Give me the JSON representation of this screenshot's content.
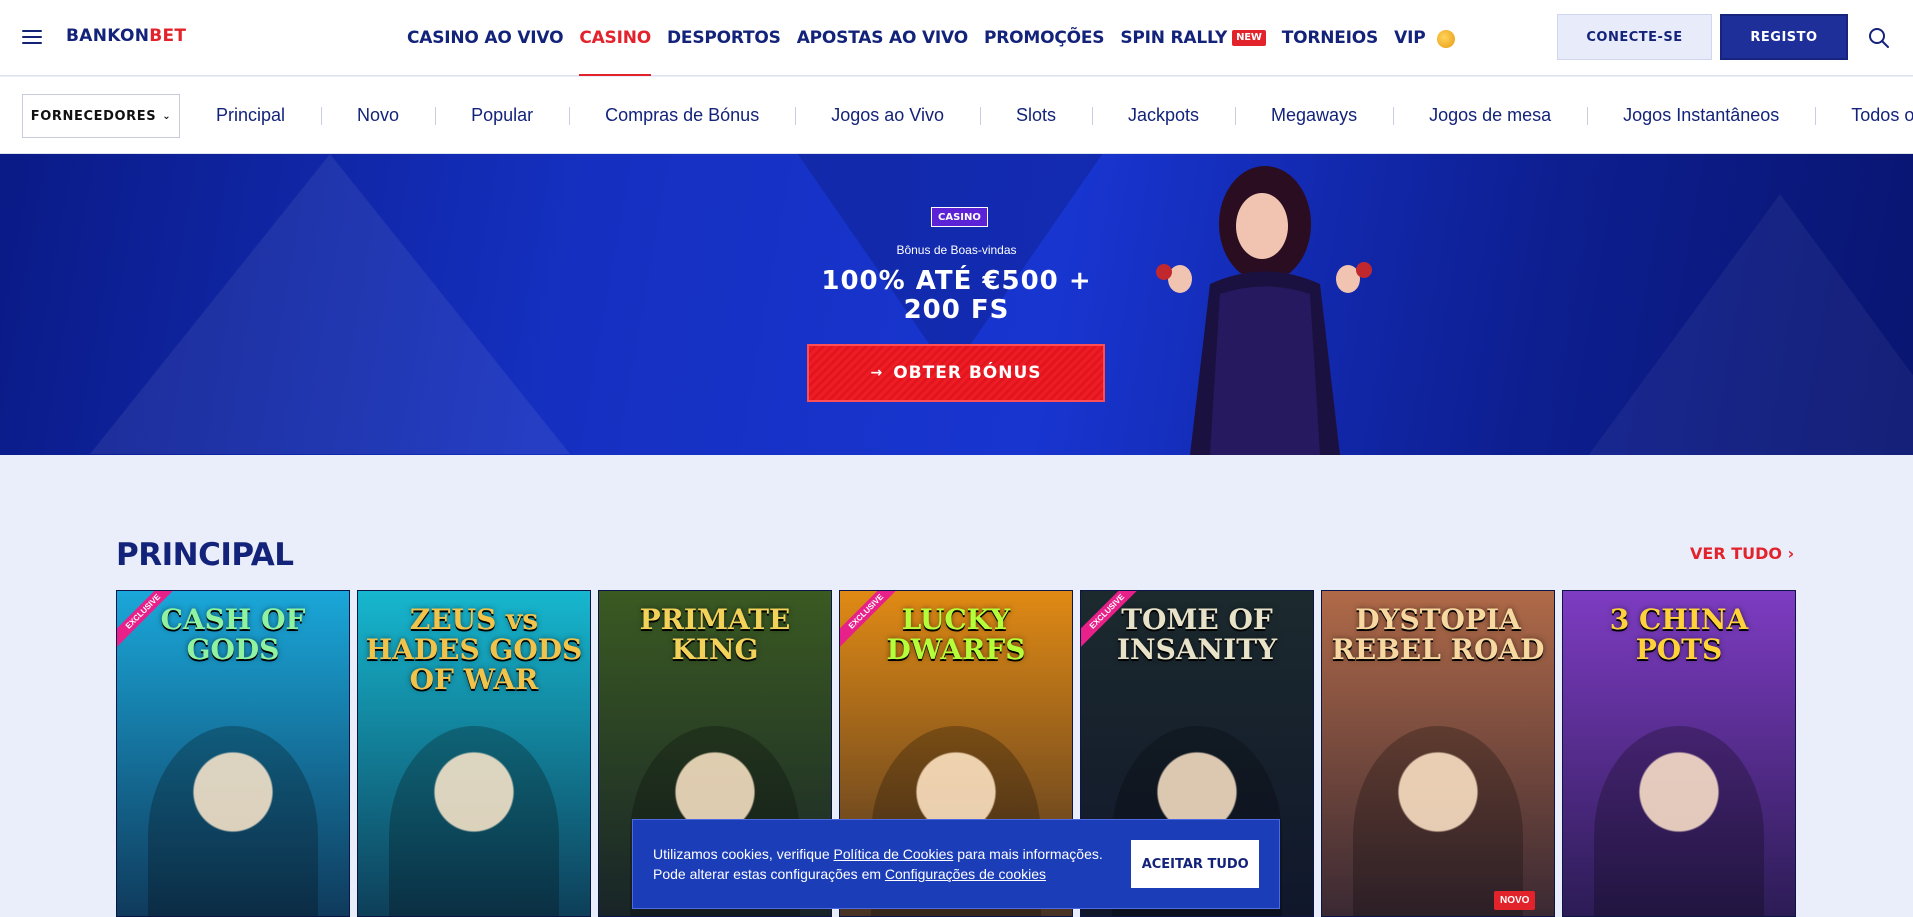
{
  "header": {
    "logo_part1": "BANKON",
    "logo_part2": "BET",
    "nav": [
      {
        "label": "CASINO AO VIVO"
      },
      {
        "label": "CASINO"
      },
      {
        "label": "DESPORTOS"
      },
      {
        "label": "APOSTAS AO VIVO"
      },
      {
        "label": "PROMOÇÕES"
      },
      {
        "label": "SPIN RALLY",
        "badge": "NEW"
      },
      {
        "label": "TORNEIOS"
      },
      {
        "label": "VIP"
      }
    ],
    "active_nav": "CASINO",
    "login_label": "CONECTE-SE",
    "register_label": "REGISTO"
  },
  "subnav": {
    "providers_label": "FORNECEDORES",
    "categories": [
      "Principal",
      "Novo",
      "Popular",
      "Compras de Bónus",
      "Jogos ao Vivo",
      "Slots",
      "Jackpots",
      "Megaways",
      "Jogos de mesa",
      "Jogos Instantâneos",
      "Todos os Jogos"
    ]
  },
  "hero": {
    "tag": "CASINO",
    "subtitle": "Bônus de Boas-vindas",
    "headline_line1": "100% ATÉ €500 +",
    "headline_line2": "200 FS",
    "cta_label": "OBTER BÓNUS"
  },
  "section": {
    "title": "PRINCIPAL",
    "see_all": "VER TUDO"
  },
  "games": [
    {
      "title": "CASH OF GODS",
      "exclusive": "EXCLUSIVE",
      "bg": "#1aa7d9",
      "title_color": "#8ff2a0"
    },
    {
      "title": "ZEUS vs HADES GODS OF WAR",
      "exclusive": "",
      "bg": "#16b7cf",
      "title_color": "#f2c34a"
    },
    {
      "title": "PRIMATE KING",
      "exclusive": "",
      "bg": "#3a5a22",
      "title_color": "#f3d25a"
    },
    {
      "title": "LUCKY DWARFS",
      "exclusive": "EXCLUSIVE",
      "bg": "#e08a14",
      "title_color": "#b4ff3a"
    },
    {
      "title": "TOME OF INSANITY",
      "exclusive": "EXCLUSIVE",
      "bg": "#1c2a2e",
      "title_color": "#e8e2c8"
    },
    {
      "title": "DYSTOPIA REBEL ROAD",
      "exclusive": "",
      "bg": "#b06a48",
      "title_color": "#f6d8a0",
      "badge": "NOVO"
    },
    {
      "title": "3 CHINA POTS",
      "exclusive": "",
      "bg": "#7e3cc2",
      "title_color": "#ffd23a"
    }
  ],
  "cookie": {
    "text_before": "Utilizamos cookies, verifique ",
    "policy_link": "Política de Cookies",
    "text_middle": " para mais informações. Pode alterar estas configurações em ",
    "settings_link": "Configurações de cookies",
    "accept_label": "ACEITAR TUDO"
  }
}
